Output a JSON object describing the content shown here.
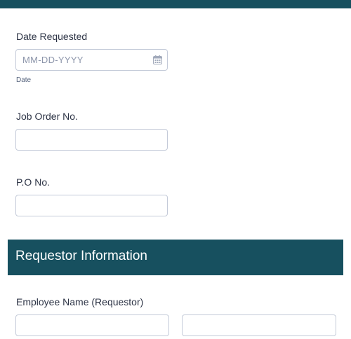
{
  "form": {
    "date_requested": {
      "label": "Date Requested",
      "placeholder": "MM-DD-YYYY",
      "sublabel": "Date",
      "icon": "calendar-icon"
    },
    "job_order": {
      "label": "Job Order No.",
      "value": ""
    },
    "po_number": {
      "label": "P.O No.",
      "value": ""
    },
    "requestor_section": {
      "title": "Requestor Information"
    },
    "employee_name": {
      "label": "Employee Name (Requestor)",
      "first": "",
      "last": ""
    }
  },
  "colors": {
    "header": "#17505f",
    "border": "#c3cad8",
    "text": "#2c3345"
  }
}
